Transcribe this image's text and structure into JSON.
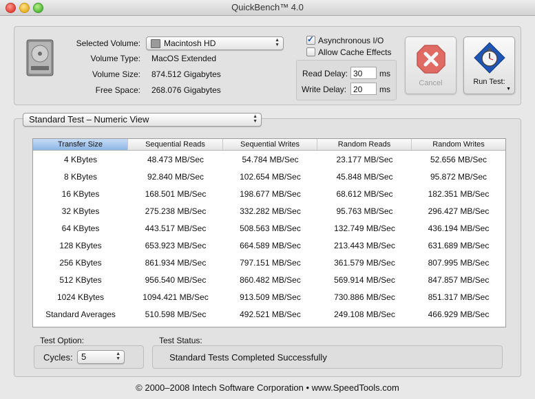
{
  "window": {
    "title": "QuickBench™ 4.0"
  },
  "volume": {
    "selected_label": "Selected Volume:",
    "selected_value": "Macintosh HD",
    "type_label": "Volume Type:",
    "type_value": "MacOS Extended",
    "size_label": "Volume Size:",
    "size_value": "874.512 Gigabytes",
    "free_label": "Free Space:",
    "free_value": "268.076 Gigabytes"
  },
  "options": {
    "async_label": "Asynchronous I/O",
    "async_checked": true,
    "cache_label": "Allow Cache Effects",
    "cache_checked": false,
    "read_delay_label": "Read Delay:",
    "read_delay_value": "30",
    "read_delay_unit": "ms",
    "write_delay_label": "Write Delay:",
    "write_delay_value": "20",
    "write_delay_unit": "ms"
  },
  "buttons": {
    "cancel_label": "Cancel",
    "run_label": "Run Test:"
  },
  "view_selector": {
    "value": "Standard Test – Numeric View"
  },
  "table": {
    "headers": [
      "Transfer Size",
      "Sequential Reads",
      "Sequential Writes",
      "Random Reads",
      "Random Writes"
    ],
    "rows": [
      [
        "4 KBytes",
        "48.473 MB/Sec",
        "54.784 MB/Sec",
        "23.177 MB/Sec",
        "52.656 MB/Sec"
      ],
      [
        "8 KBytes",
        "92.840 MB/Sec",
        "102.654 MB/Sec",
        "45.848 MB/Sec",
        "95.872 MB/Sec"
      ],
      [
        "16 KBytes",
        "168.501 MB/Sec",
        "198.677 MB/Sec",
        "68.612 MB/Sec",
        "182.351 MB/Sec"
      ],
      [
        "32 KBytes",
        "275.238 MB/Sec",
        "332.282 MB/Sec",
        "95.763 MB/Sec",
        "296.427 MB/Sec"
      ],
      [
        "64 KBytes",
        "443.517 MB/Sec",
        "508.563 MB/Sec",
        "132.749 MB/Sec",
        "436.194 MB/Sec"
      ],
      [
        "128 KBytes",
        "653.923 MB/Sec",
        "664.589 MB/Sec",
        "213.443 MB/Sec",
        "631.689 MB/Sec"
      ],
      [
        "256 KBytes",
        "861.934 MB/Sec",
        "797.151 MB/Sec",
        "361.579 MB/Sec",
        "807.995 MB/Sec"
      ],
      [
        "512 KBytes",
        "956.540 MB/Sec",
        "860.482 MB/Sec",
        "569.914 MB/Sec",
        "847.857 MB/Sec"
      ],
      [
        "1024 KBytes",
        "1094.421 MB/Sec",
        "913.509 MB/Sec",
        "730.886 MB/Sec",
        "851.317 MB/Sec"
      ],
      [
        "Standard Averages",
        "510.598 MB/Sec",
        "492.521 MB/Sec",
        "249.108 MB/Sec",
        "466.929 MB/Sec"
      ]
    ]
  },
  "test_option": {
    "label": "Test Option:",
    "cycles_label": "Cycles:",
    "cycles_value": "5"
  },
  "test_status": {
    "label": "Test Status:",
    "value": "Standard Tests Completed Successfully"
  },
  "footer": {
    "text": "© 2000–2008 Intech Software Corporation • www.SpeedTools.com"
  },
  "colors": {
    "sorted_header": "#8db6e6",
    "cancel_red": "#e0443a",
    "check_blue": "#1c4ea8"
  }
}
